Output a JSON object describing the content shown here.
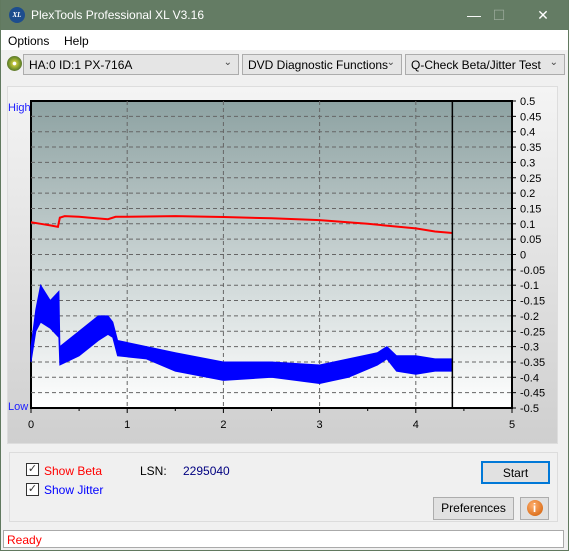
{
  "window": {
    "title": "PlexTools Professional XL V3.16",
    "logo_text": "XL",
    "minimize": "—",
    "maximize": "☐",
    "close": "✕"
  },
  "menu": [
    {
      "label": "Options"
    },
    {
      "label": "Help"
    }
  ],
  "toolbar": {
    "drive": "HA:0 ID:1  PX-716A",
    "category": "DVD Diagnostic Functions",
    "test": "Q-Check Beta/Jitter Test"
  },
  "chart_labels": {
    "high": "High",
    "low": "Low"
  },
  "chart_data": {
    "type": "line",
    "xlim": [
      0,
      5
    ],
    "ylim": [
      -0.5,
      0.5
    ],
    "x_ticks": [
      "0",
      "1",
      "2",
      "3",
      "4",
      "5"
    ],
    "y_ticks": [
      "0.5",
      "0.45",
      "0.4",
      "0.35",
      "0.3",
      "0.25",
      "0.2",
      "0.15",
      "0.1",
      "0.05",
      "0",
      "-0.05",
      "-0.1",
      "-0.15",
      "-0.2",
      "-0.25",
      "-0.3",
      "-0.35",
      "-0.4",
      "-0.45",
      "-0.5"
    ],
    "grid": true,
    "marker_x": 4.38,
    "series": [
      {
        "key": "beta",
        "color": "#ff0000",
        "x": [
          0,
          0.1,
          0.2,
          0.28,
          0.3,
          0.35,
          0.5,
          0.6,
          0.8,
          0.88,
          1.0,
          1.5,
          2.0,
          2.5,
          3.0,
          3.5,
          4.0,
          4.2,
          4.38
        ],
        "values": [
          0.105,
          0.1,
          0.095,
          0.09,
          0.12,
          0.125,
          0.123,
          0.12,
          0.115,
          0.123,
          0.123,
          0.125,
          0.122,
          0.118,
          0.112,
          0.1,
          0.085,
          0.075,
          0.07
        ]
      },
      {
        "key": "jitter",
        "color": "#0000ff",
        "x": [
          0,
          0.05,
          0.1,
          0.2,
          0.29,
          0.3,
          0.5,
          0.7,
          0.8,
          0.85,
          0.9,
          1.2,
          1.5,
          2.0,
          2.5,
          3.0,
          3.3,
          3.6,
          3.7,
          3.8,
          4.0,
          4.2,
          4.38
        ],
        "min": [
          -0.35,
          -0.25,
          -0.22,
          -0.24,
          -0.27,
          -0.36,
          -0.33,
          -0.28,
          -0.26,
          -0.27,
          -0.33,
          -0.34,
          -0.38,
          -0.41,
          -0.4,
          -0.42,
          -0.4,
          -0.36,
          -0.34,
          -0.38,
          -0.39,
          -0.38,
          -0.38
        ],
        "max": [
          -0.3,
          -0.18,
          -0.1,
          -0.15,
          -0.12,
          -0.3,
          -0.25,
          -0.2,
          -0.2,
          -0.22,
          -0.28,
          -0.3,
          -0.32,
          -0.35,
          -0.35,
          -0.36,
          -0.34,
          -0.32,
          -0.3,
          -0.33,
          -0.33,
          -0.34,
          -0.34
        ]
      }
    ]
  },
  "controls": {
    "show_beta": "Show Beta",
    "show_jitter": "Show Jitter",
    "show_beta_checked": true,
    "show_jitter_checked": true,
    "lsn_label": "LSN:",
    "lsn_value": "2295040",
    "start": "Start",
    "preferences": "Preferences",
    "info_icon": "i"
  },
  "status": "Ready",
  "colors": {
    "beta": "#ff0000",
    "jitter": "#0000ff",
    "title_bar": "#647c64"
  }
}
